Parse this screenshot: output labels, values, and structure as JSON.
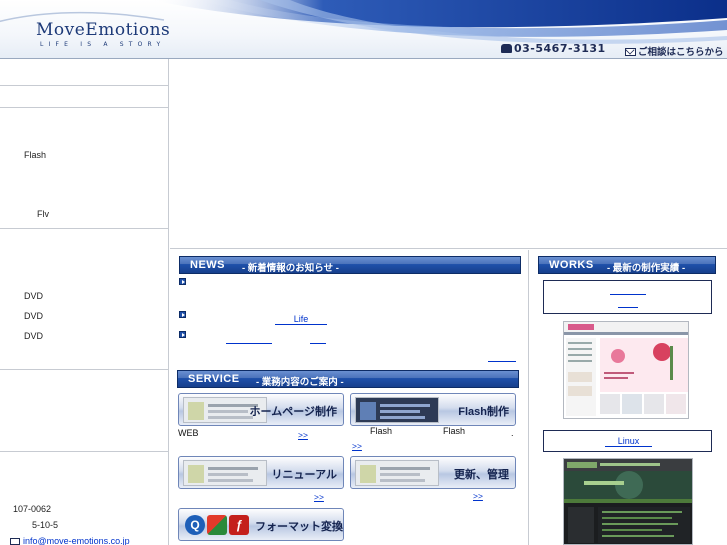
{
  "header": {
    "logo": {
      "name": "MoveEmotions",
      "tagline": "LIFE IS A STORY"
    },
    "phone": "03-5467-3131",
    "contact_label": "ご相談はこちらから"
  },
  "sidebar": {
    "flash_label": "Flash",
    "flv_label": "Flv",
    "dvd_items": [
      "DVD",
      "DVD",
      "DVD"
    ],
    "address": {
      "postal": "107-0062",
      "street": "5-10-5",
      "email": "info@move-emotions.co.jp"
    }
  },
  "news": {
    "heading_en": "NEWS",
    "heading_jp": "- 新着情報のお知らせ -",
    "item2_link": "Life",
    "more_link": ""
  },
  "service": {
    "heading_en": "SERVICE",
    "heading_jp": "- 業務内容のご案内 -",
    "buttons": {
      "homepage": "ホームページ制作",
      "flash": "Flash制作",
      "renewal": "リニューアル",
      "update": "更新、管理",
      "format": "フォーマット変換"
    },
    "texts": {
      "web": "WEB",
      "flash1": "Flash",
      "flash2": "Flash",
      "dot": "."
    },
    "more": ">>"
  },
  "works": {
    "heading_en": "WORKS",
    "heading_jp": "- 最新の制作実績 -",
    "box2_link": "Linux"
  },
  "colors": {
    "brand_blue": "#1e4fa8",
    "link": "#0033cc",
    "divider": "#c7cbd2"
  }
}
